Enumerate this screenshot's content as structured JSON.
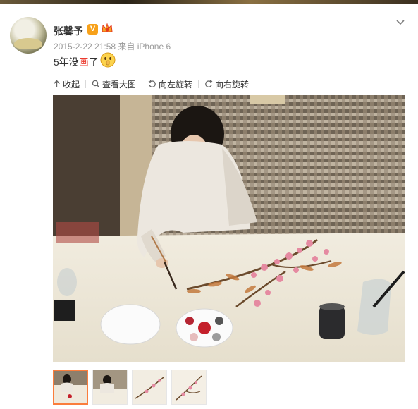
{
  "post": {
    "author": "张馨予",
    "verified_badge": "V",
    "timestamp": "2015-2-22 21:58",
    "source": "来自 iPhone 6",
    "text_before": "5年没",
    "text_highlight": "画",
    "text_after": "了",
    "emoji": "shush-face-emoji"
  },
  "toolbar": {
    "collapse": "收起",
    "view_large": "查看大图",
    "rotate_left": "向左旋转",
    "rotate_right": "向右旋转"
  },
  "thumbnails": {
    "count": 4,
    "selected_index": 0
  },
  "colors": {
    "accent": "#fa7d3c",
    "highlight_text": "#eb3b2f",
    "meta_text": "#999999",
    "vip_badge": "#f7a11a"
  }
}
